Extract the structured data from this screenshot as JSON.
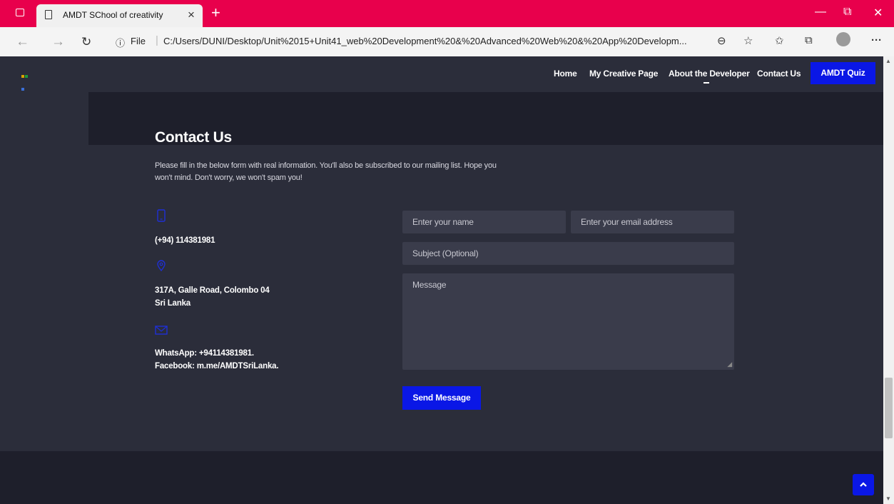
{
  "browser": {
    "tab_title": "AMDT SChool of creativity",
    "tab_close": "×",
    "new_tab": "+",
    "url_prefix": "File",
    "url": "C:/Users/DUNI/Desktop/Unit%2015+Unit41_web%20Development%20&%20Advanced%20Web%20&%20App%20Developm...",
    "window_controls": [
      "—",
      "⧉",
      "✕"
    ]
  },
  "header": {
    "nav": [
      "Home",
      "My Creative Page",
      "About the Developer",
      "Contact Us"
    ],
    "quiz_button": "AMDT Quiz"
  },
  "contact": {
    "title": "Contact Us",
    "intro_line1": "Please fill in the below form with real information. You'll also be subscribed to our mailing list. Hope you",
    "intro_line2": "won't mind. Don't worry, we won't spam you!",
    "phone": "(+94) 114381981",
    "address_line1": "317A, Galle Road, Colombo 04",
    "address_line2": "Sri Lanka",
    "whatsapp": "WhatsApp: +94114381981.",
    "facebook": "Facebook: m.me/AMDTSriLanka."
  },
  "form": {
    "name_placeholder": "Enter your name",
    "email_placeholder": "Enter your email address",
    "subject_placeholder": "Subject (Optional)",
    "message_placeholder": "Message",
    "send_button": "Send Message"
  },
  "icons": {
    "phone": "phone-icon",
    "location": "location-pin-icon",
    "mail": "envelope-icon",
    "to_top": "chevron-up-icon"
  },
  "colors": {
    "chrome_accent": "#e8004c",
    "page_bg": "#2b2d3a",
    "band_bg": "#1e1f2b",
    "button_blue": "#0a17e6",
    "field_bg": "#3a3c4b"
  }
}
